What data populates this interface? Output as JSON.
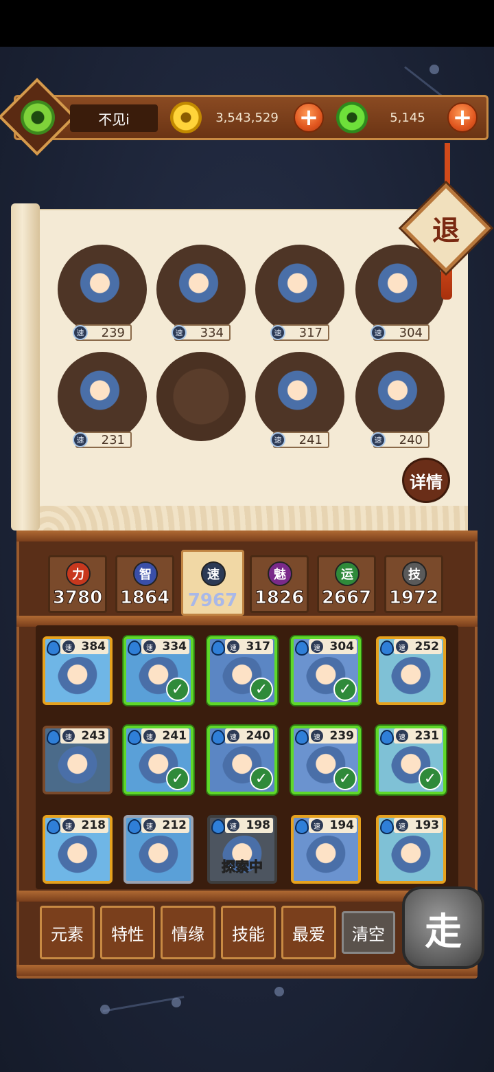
{
  "player": {
    "name": "不见i"
  },
  "currency": {
    "gold": {
      "value": "3,543,529"
    },
    "jade": {
      "value": "5,145"
    },
    "add_label": "+"
  },
  "retreat_label": "退",
  "detail_label": "详情",
  "speed_glyph": "速",
  "team_slots": [
    {
      "speed": "239",
      "empty": false
    },
    {
      "speed": "334",
      "empty": false
    },
    {
      "speed": "317",
      "empty": false
    },
    {
      "speed": "304",
      "empty": false
    },
    {
      "speed": "231",
      "empty": false
    },
    {
      "speed": "",
      "empty": true
    },
    {
      "speed": "241",
      "empty": false
    },
    {
      "speed": "240",
      "empty": false
    }
  ],
  "attributes": [
    {
      "glyph": "力",
      "value": "3780",
      "color": "#c8381e",
      "selected": false
    },
    {
      "glyph": "智",
      "value": "1864",
      "color": "#3a4fa8",
      "selected": false
    },
    {
      "glyph": "速",
      "value": "7967",
      "color": "#2c3a55",
      "selected": true
    },
    {
      "glyph": "魅",
      "value": "1826",
      "color": "#7a2a8a",
      "selected": false
    },
    {
      "glyph": "运",
      "value": "2667",
      "color": "#2f8a3a",
      "selected": false
    },
    {
      "glyph": "技",
      "value": "1972",
      "color": "#5a5a5a",
      "selected": false
    }
  ],
  "roster": [
    {
      "speed": "384",
      "state": "normal"
    },
    {
      "speed": "334",
      "state": "picked"
    },
    {
      "speed": "317",
      "state": "picked"
    },
    {
      "speed": "304",
      "state": "picked"
    },
    {
      "speed": "252",
      "state": "normal"
    },
    {
      "speed": "243",
      "state": "brown"
    },
    {
      "speed": "241",
      "state": "picked"
    },
    {
      "speed": "240",
      "state": "picked"
    },
    {
      "speed": "239",
      "state": "picked"
    },
    {
      "speed": "231",
      "state": "picked"
    },
    {
      "speed": "218",
      "state": "normal"
    },
    {
      "speed": "212",
      "state": "grey"
    },
    {
      "speed": "198",
      "state": "exploring",
      "label": "探索中"
    },
    {
      "speed": "194",
      "state": "normal"
    },
    {
      "speed": "193",
      "state": "normal"
    }
  ],
  "filters": [
    "元素",
    "特性",
    "情缘",
    "技能",
    "最爱"
  ],
  "clear_label": "清空",
  "go_label": "走"
}
